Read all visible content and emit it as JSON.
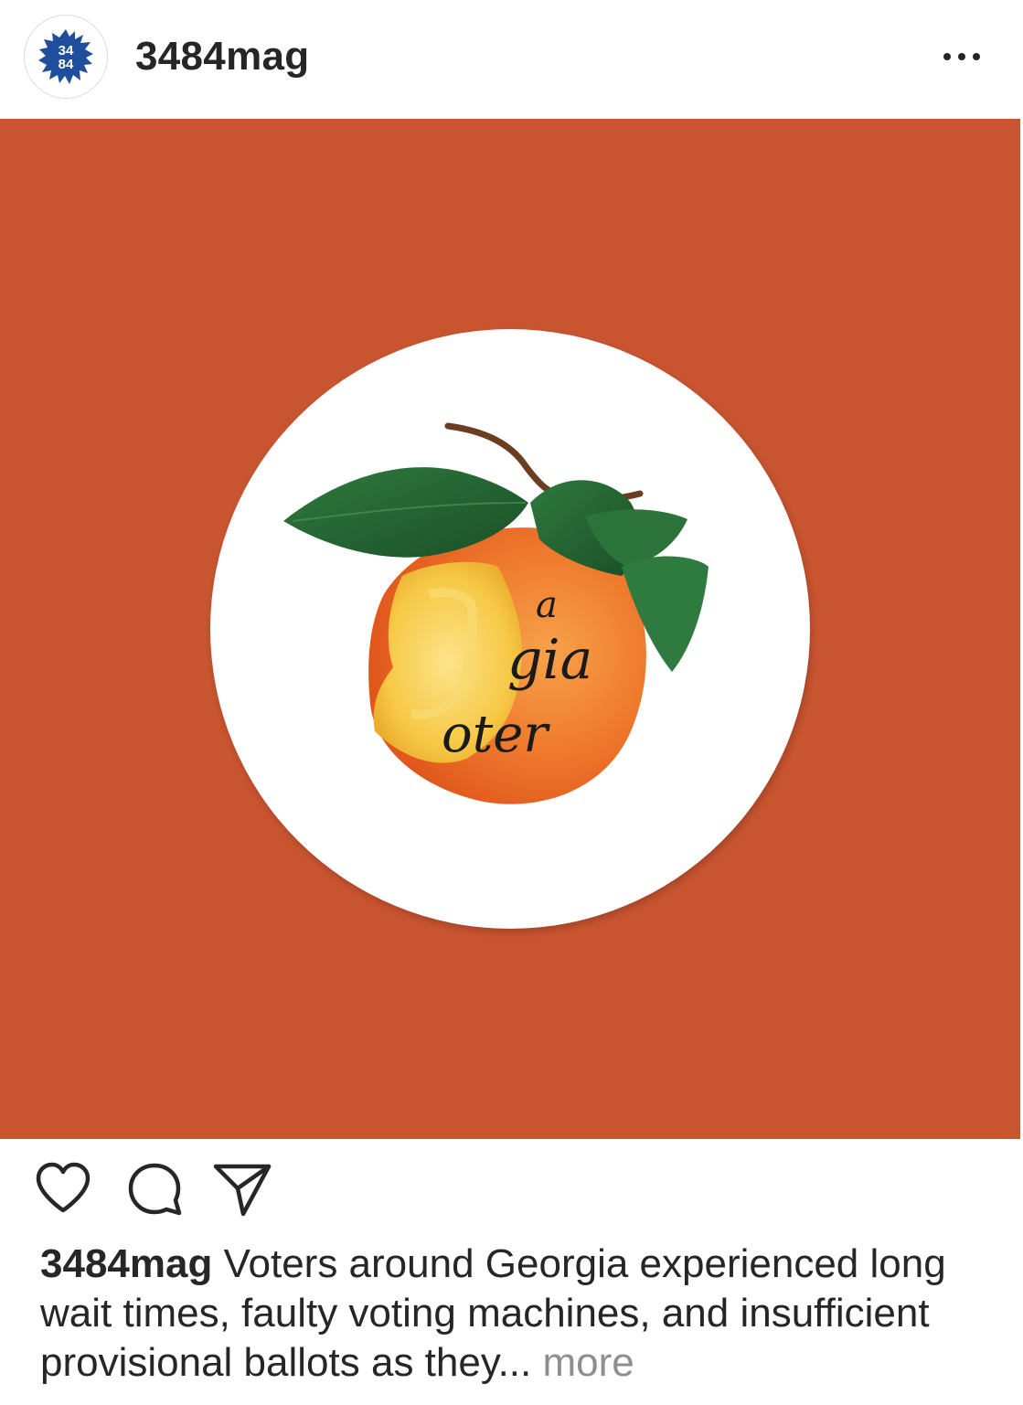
{
  "post": {
    "username": "3484mag",
    "avatar_text_top": "34",
    "avatar_text_bottom": "84",
    "more_icon": "more-horizontal-icon",
    "image": {
      "background_color": "#c95430",
      "badge_color": "#ffffff",
      "sticker_text_line1": "a",
      "sticker_text_line2": "gia",
      "sticker_text_line3": "oter"
    },
    "actions": {
      "like_icon": "heart-icon",
      "comment_icon": "comment-icon",
      "share_icon": "send-icon"
    },
    "caption": {
      "username": "3484mag",
      "text": " Voters around Georgia experienced long wait times, faulty voting machines, and insufficient provisional ballots as they... ",
      "more_label": "more"
    }
  },
  "colors": {
    "brand_blue": "#1f4e9c",
    "text": "#262626",
    "muted": "#8e8e8e"
  }
}
